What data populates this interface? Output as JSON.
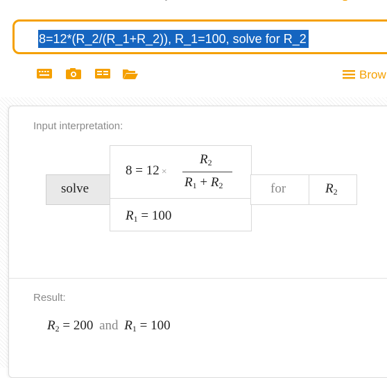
{
  "query": {
    "text": "8=12*(R_2/(R_1+R_2)), R_1=100, solve for R_2"
  },
  "toolbar": {
    "icons": [
      "keyboard-icon",
      "camera-icon",
      "table-icon",
      "folder-open-icon"
    ],
    "browse_label": "Brow"
  },
  "interpretation": {
    "label": "Input interpretation:",
    "solve_label": "solve",
    "eq_lhs": "8",
    "eq_eq": "=",
    "eq_coef": "12",
    "eq_times": "×",
    "numerator_var": "R",
    "numerator_sub": "2",
    "den_var1": "R",
    "den_sub1": "1",
    "den_plus": "+",
    "den_var2": "R",
    "den_sub2": "2",
    "cond_var": "R",
    "cond_sub": "1",
    "cond_eq": "=",
    "cond_val": "100",
    "for_label": "for",
    "for_var": "R",
    "for_sub": "2"
  },
  "result": {
    "label": "Result:",
    "var1": "R",
    "sub1": "2",
    "eq1": "=",
    "val1": "200",
    "and_label": "and",
    "var2": "R",
    "sub2": "1",
    "eq2": "=",
    "val2": "100"
  },
  "colors": {
    "accent": "#f5a000",
    "selection": "#1565c0"
  }
}
